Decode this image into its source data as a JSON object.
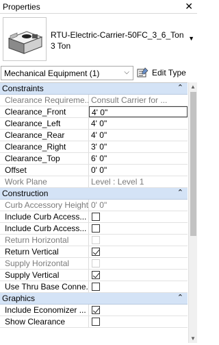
{
  "panel": {
    "title": "Properties",
    "close": "✕"
  },
  "type_selector": {
    "family_name": "RTU-Electric-Carrier-50FC_3_6_Ton",
    "type_name": "3 Ton"
  },
  "category_filter": {
    "selected": "Mechanical Equipment (1)"
  },
  "edit_type_label": "Edit Type",
  "sections": {
    "constraints": "Constraints",
    "construction": "Construction",
    "graphics": "Graphics"
  },
  "params": {
    "clearance_req": {
      "name": "Clearance Requireme...",
      "value": "Consult Carrier for ..."
    },
    "clearance_front": {
      "name": "Clearance_Front",
      "value": "4'  0\""
    },
    "clearance_left": {
      "name": "Clearance_Left",
      "value": "4'  0\""
    },
    "clearance_rear": {
      "name": "Clearance_Rear",
      "value": "4'  0\""
    },
    "clearance_right": {
      "name": "Clearance_Right",
      "value": "3'  0\""
    },
    "clearance_top": {
      "name": "Clearance_Top",
      "value": "6'  0\""
    },
    "offset": {
      "name": "Offset",
      "value": "0'  0\""
    },
    "work_plane": {
      "name": "Work Plane",
      "value": "Level : Level 1"
    },
    "curb_height": {
      "name": "Curb Accessory Height",
      "value": "0'  0\""
    },
    "include_curb_1": {
      "name": "Include Curb Access...",
      "checked": false
    },
    "include_curb_2": {
      "name": "Include Curb Access...",
      "checked": false
    },
    "return_horizontal": {
      "name": "Return Horizontal",
      "checked": false
    },
    "return_vertical": {
      "name": "Return Vertical",
      "checked": true
    },
    "supply_horizontal": {
      "name": "Supply Horizontal",
      "checked": false
    },
    "supply_vertical": {
      "name": "Supply Vertical",
      "checked": true
    },
    "thru_base": {
      "name": "Use Thru Base Conne...",
      "checked": false
    },
    "include_economizer": {
      "name": "Include Economizer ...",
      "checked": true
    },
    "show_clearance": {
      "name": "Show Clearance",
      "checked": false
    }
  },
  "colors": {
    "section_header": "#d4e3f6",
    "disabled_text": "#7a7a7a"
  }
}
